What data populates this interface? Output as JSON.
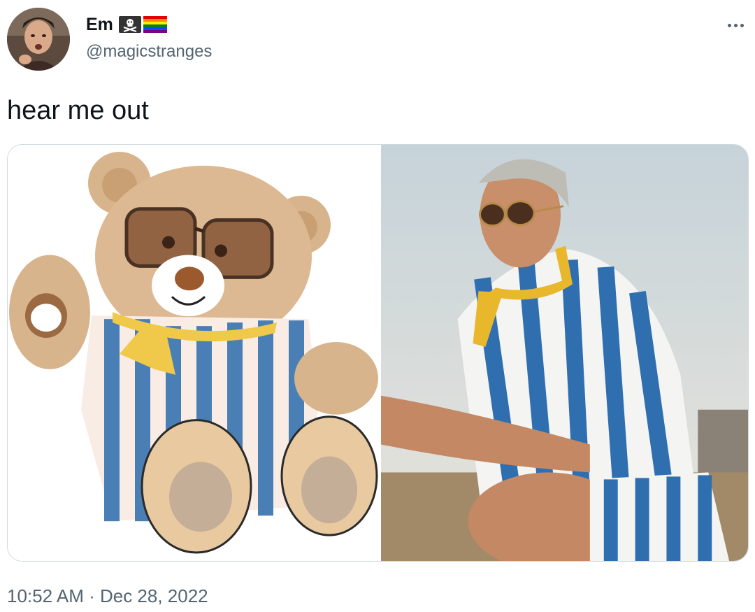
{
  "author": {
    "display_name": "Em",
    "handle": "@magicstranges",
    "name_emojis": [
      "pirate-flag-emoji",
      "rainbow-flag-emoji"
    ]
  },
  "tweet": {
    "text": "hear me out",
    "time": "10:52 AM",
    "separator": " · ",
    "date": "Dec 28, 2022"
  },
  "media": {
    "count": 2,
    "items": [
      "teddy-bear-illustration",
      "man-in-striped-suit-photo"
    ]
  },
  "icons": {
    "more": "more-horizontal-icon"
  },
  "colors": {
    "text_primary": "#0f1419",
    "text_secondary": "#536471",
    "media_border": "#cfd9de",
    "stripe_blue": "#4a7fb5",
    "scarf_yellow": "#f0c84a"
  }
}
